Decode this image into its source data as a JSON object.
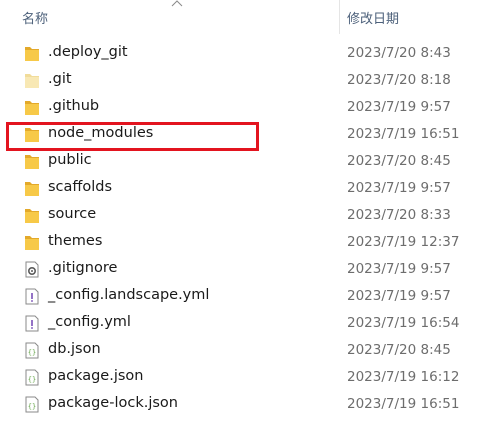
{
  "header": {
    "name_label": "名称",
    "date_label": "修改日期",
    "sort_icon": "chevron-up-icon"
  },
  "rows": [
    {
      "name": ".deploy_git",
      "date": "2023/7/20 8:43",
      "type": "folder"
    },
    {
      "name": ".git",
      "date": "2023/7/20 8:18",
      "type": "folder-faded"
    },
    {
      "name": ".github",
      "date": "2023/7/19 9:57",
      "type": "folder"
    },
    {
      "name": "node_modules",
      "date": "2023/7/19 16:51",
      "type": "folder"
    },
    {
      "name": "public",
      "date": "2023/7/20 8:45",
      "type": "folder"
    },
    {
      "name": "scaffolds",
      "date": "2023/7/19 9:57",
      "type": "folder"
    },
    {
      "name": "source",
      "date": "2023/7/20 8:33",
      "type": "folder"
    },
    {
      "name": "themes",
      "date": "2023/7/19 12:37",
      "type": "folder"
    },
    {
      "name": ".gitignore",
      "date": "2023/7/19 9:57",
      "type": "settings-file"
    },
    {
      "name": "_config.landscape.yml",
      "date": "2023/7/19 9:57",
      "type": "yml-file"
    },
    {
      "name": "_config.yml",
      "date": "2023/7/19 16:54",
      "type": "yml-file"
    },
    {
      "name": "db.json",
      "date": "2023/7/20 8:45",
      "type": "json-file"
    },
    {
      "name": "package.json",
      "date": "2023/7/19 16:12",
      "type": "json-file"
    },
    {
      "name": "package-lock.json",
      "date": "2023/7/19 16:51",
      "type": "json-file"
    }
  ],
  "highlight": {
    "target": "node_modules",
    "color": "#e3141f"
  },
  "colors": {
    "folder": "#f7c948",
    "folder_dark": "#e3a92a",
    "header_text": "#4c607a",
    "date_text": "#6d6d6d"
  }
}
